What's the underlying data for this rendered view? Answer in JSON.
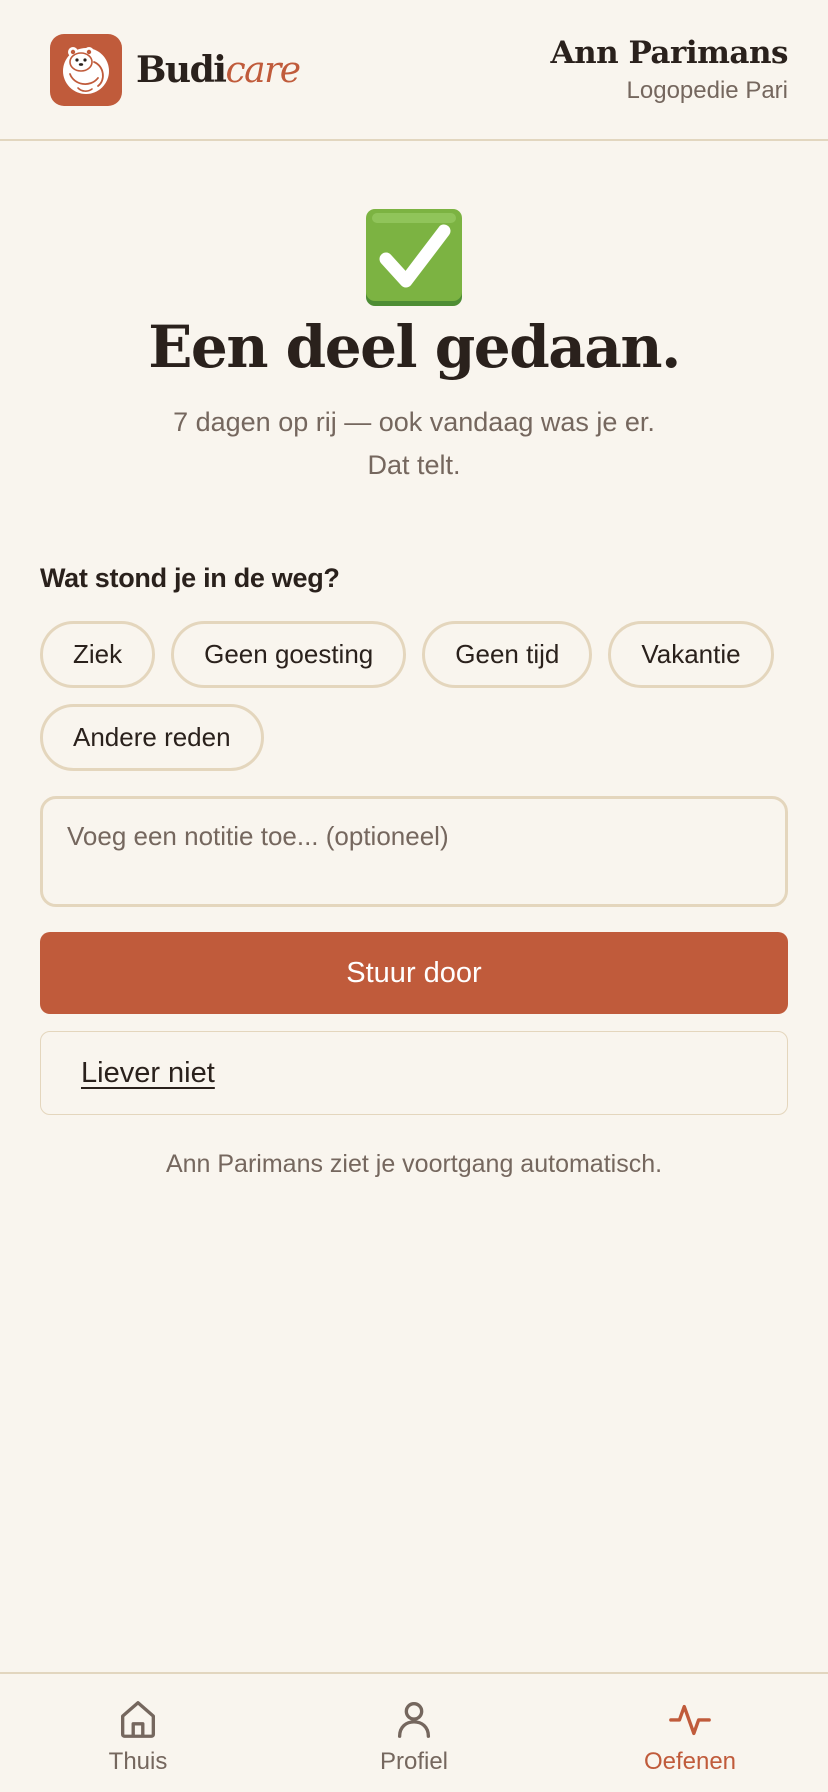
{
  "colors": {
    "accent": "#c05b3b",
    "background": "#f9f5ee",
    "text": "#2a211c",
    "muted_text": "#75675e",
    "border": "#e4d6bd",
    "success_green": "#7cb342"
  },
  "header": {
    "brand": {
      "part1": "Budi",
      "part2": "care",
      "logo_icon": "otter-logo-icon"
    },
    "user": {
      "name": "Ann Parimans",
      "practice": "Logopedie Pari"
    }
  },
  "completion": {
    "icon": "check-mark-button-icon",
    "headline": "Een deel gedaan.",
    "streak_line": "7 dagen op rij — ook vandaag was je er.",
    "encouragement": "Dat telt."
  },
  "obstacles": {
    "question": "Wat stond je in de weg?",
    "options": [
      {
        "label": "Ziek"
      },
      {
        "label": "Geen goesting"
      },
      {
        "label": "Geen tijd"
      },
      {
        "label": "Vakantie"
      },
      {
        "label": "Andere reden"
      }
    ]
  },
  "note": {
    "placeholder": "Voeg een notitie toe... (optioneel)",
    "value": ""
  },
  "actions": {
    "submit_label": "Stuur door",
    "decline_label": "Liever niet"
  },
  "footnote": "Ann Parimans ziet je voortgang automatisch.",
  "nav": {
    "items": [
      {
        "label": "Thuis",
        "icon": "home-icon",
        "active": false
      },
      {
        "label": "Profiel",
        "icon": "user-icon",
        "active": false
      },
      {
        "label": "Oefenen",
        "icon": "activity-icon",
        "active": true
      }
    ]
  }
}
